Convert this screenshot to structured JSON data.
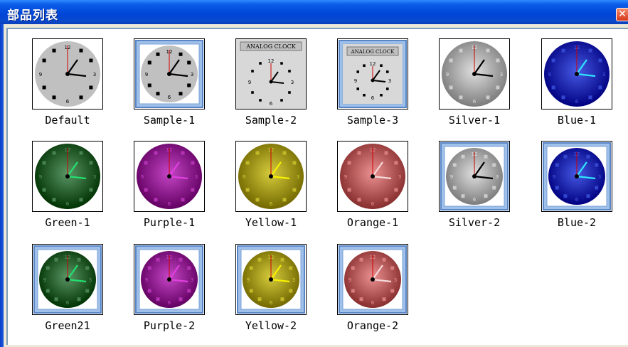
{
  "window": {
    "title": "部品列表",
    "close_glyph": "✕"
  },
  "items": [
    {
      "label": "Default",
      "style": "default"
    },
    {
      "label": "Sample-1",
      "style": "framed-gray"
    },
    {
      "label": "Sample-2",
      "style": "analog"
    },
    {
      "label": "Sample-3",
      "style": "analog-framed"
    },
    {
      "label": "Silver-1",
      "style": "color",
      "face": "#a4a4a4",
      "hand": "#000000"
    },
    {
      "label": "Blue-1",
      "style": "color",
      "face": "#0a1ea8",
      "hand": "#2ee6ff"
    },
    {
      "label": "Green-1",
      "style": "color",
      "face": "#1f5a2a",
      "hand": "#22e070"
    },
    {
      "label": "Purple-1",
      "style": "color",
      "face": "#8a0a8a",
      "hand": "#e040e0"
    },
    {
      "label": "Yellow-1",
      "style": "color",
      "face": "#9a9000",
      "hand": "#f8f000"
    },
    {
      "label": "Orange-1",
      "style": "color",
      "face": "#b05555",
      "hand": "#f4d8d8"
    },
    {
      "label": "Silver-2",
      "style": "color-framed",
      "face": "#a4a4a4",
      "hand": "#000000"
    },
    {
      "label": "Blue-2",
      "style": "color-framed",
      "face": "#0a1ea8",
      "hand": "#2ee6ff"
    },
    {
      "label": "Green21",
      "style": "color-framed",
      "face": "#1f5a2a",
      "hand": "#22e070"
    },
    {
      "label": "Purple-2",
      "style": "color-framed",
      "face": "#8a0a8a",
      "hand": "#e040e0"
    },
    {
      "label": "Yellow-2",
      "style": "color-framed",
      "face": "#9a9000",
      "hand": "#f8f000"
    },
    {
      "label": "Orange-2",
      "style": "color-framed",
      "face": "#b05555",
      "hand": "#f4d8d8"
    }
  ],
  "clock": {
    "numeral_12": "12",
    "numeral_3": "3",
    "numeral_6": "6",
    "numeral_9": "9",
    "banner": "ANALOG CLOCK"
  }
}
